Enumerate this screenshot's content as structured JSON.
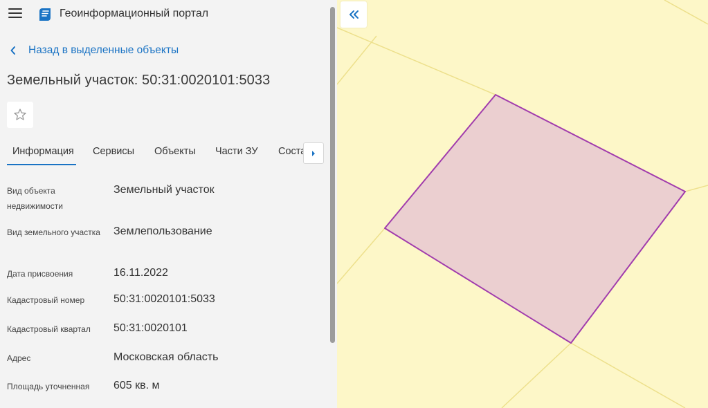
{
  "header": {
    "title": "Геоинформационный портал",
    "menu_icon": "hamburger-menu-icon",
    "logo_icon": "portal-logo-icon"
  },
  "back_link": {
    "label": "Назад в выделенные объекты"
  },
  "object": {
    "title": "Земельный участок: 50:31:0020101:5033"
  },
  "favorite": {
    "icon": "star-icon"
  },
  "tabs": [
    {
      "label": "Информация",
      "active": true
    },
    {
      "label": "Сервисы"
    },
    {
      "label": "Объекты"
    },
    {
      "label": "Части ЗУ"
    },
    {
      "label": "Соста"
    }
  ],
  "attributes": [
    {
      "label": "Вид объекта недвижимости",
      "value": "Земельный участок"
    },
    {
      "label": "Вид земельного участка",
      "value": "Землепользование"
    },
    {
      "label": "Дата присвоения",
      "value": "16.11.2022"
    },
    {
      "label": "Кадастровый номер",
      "value": "50:31:0020101:5033"
    },
    {
      "label": "Кадастровый квартал",
      "value": "50:31:0020101"
    },
    {
      "label": "Адрес",
      "value": "Московская область"
    },
    {
      "label": "Площадь уточненная",
      "value": "605 кв. м"
    }
  ],
  "colors": {
    "accent": "#1a73c4",
    "map_background": "#fdf7c8",
    "parcel_fill": "#ebcfd0",
    "parcel_border": "#a13cad",
    "map_lines": "#ede08c"
  }
}
